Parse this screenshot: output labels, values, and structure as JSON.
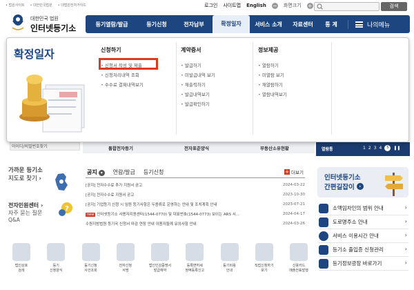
{
  "top": {
    "links": [
      "• 법원사이트",
      "• 대한민국법원",
      "• 대법원전자가이드"
    ],
    "login": "로그인",
    "sitemap": "사이트맵",
    "english": "English",
    "zoom_label": "화면크기",
    "search_button": "검색"
  },
  "logo": {
    "line1": "대한민국 법원",
    "line2": "인터넷등기소"
  },
  "gnb": {
    "items": [
      "등기열람/발급",
      "등기신청",
      "전자납부",
      "확정일자",
      "서비스 소개",
      "자료센터",
      "통 계"
    ],
    "my_menu": "나의메뉴"
  },
  "dropdown": {
    "title": "확정일자",
    "columns": [
      {
        "heading": "신청하기",
        "items": [
          "신청서 작성 및 제출",
          "신청처리내역 조회",
          "수수료 결제내역보기"
        ]
      },
      {
        "heading": "계약증서",
        "items": [
          "발급하기",
          "미발급내역 보기",
          "재출력하기",
          "발급내역보기",
          "발급확인하기"
        ]
      },
      {
        "heading": "정보제공",
        "items": [
          "열람하기",
          "미열람 보기",
          "재열람하기",
          "열람내역보기"
        ]
      }
    ]
  },
  "strip": {
    "id_link": "아이디/비밀번호찾기",
    "tabs": [
      "통합전자등기",
      "전자표준양식",
      "부동산소유현황"
    ],
    "slide_label": "열람통",
    "slide_pages": [
      "1",
      "2",
      "3",
      "4",
      "5"
    ]
  },
  "left": {
    "office_a": "가까운 등기소",
    "office_b": "지도로 찾기 ›",
    "center_a": "전자민원센터 ›",
    "center_b": "자주 묻는 질문",
    "center_c": "Q&A"
  },
  "news": {
    "tabs": [
      "공지",
      "연람/발급",
      "등기신청"
    ],
    "more": "더보기",
    "rows": [
      {
        "new": false,
        "title": "[공지] 전자수수료 추가 지원서 공고",
        "date": "2024-03-22"
      },
      {
        "new": false,
        "title": "[공지] 전자수수료 지원서 공고",
        "date": "2023-10-30"
      },
      {
        "new": false,
        "title": "[공지] 기업등기 신청 시 임원 등기사항은 두종류로 운영하는 안내 및 조치계획 안내",
        "date": "2023-07-21"
      },
      {
        "new": true,
        "title": "인터넷등기소 사용자지원센터(1544-0770) 및 대표번호(1544-0773) 보이는 ARS 서...",
        "date": "2024-04-17"
      },
      {
        "new": false,
        "title": "수원지방법원 등기국 신청서 마감 연장 안내 이용자들께 유의사항 안내",
        "date": "2024-03-26"
      }
    ],
    "new_badge": "new"
  },
  "promo": {
    "line1": "인터넷등기소",
    "line2": "간편길잡이"
  },
  "quick": [
    "소액임차인의 범위 안내",
    "도로명주소 안내",
    "서비스 이용시간 안내",
    "등기소 출입증 신청관리",
    "등기정보광장 바로가기"
  ],
  "bottom_icons": [
    [
      "법인상호",
      "검색"
    ],
    [
      "등기",
      "신청양식"
    ],
    [
      "등기신청",
      "사건조회"
    ],
    [
      "전자신청",
      "서명"
    ],
    [
      "법인인감증명서",
      "발급예약"
    ],
    [
      "등록면허세",
      "정액등록신고"
    ],
    [
      "등기비용",
      "안내"
    ],
    [
      "직접신청하기",
      "보기"
    ],
    [
      "신용카드",
      "매출전표발행"
    ]
  ]
}
